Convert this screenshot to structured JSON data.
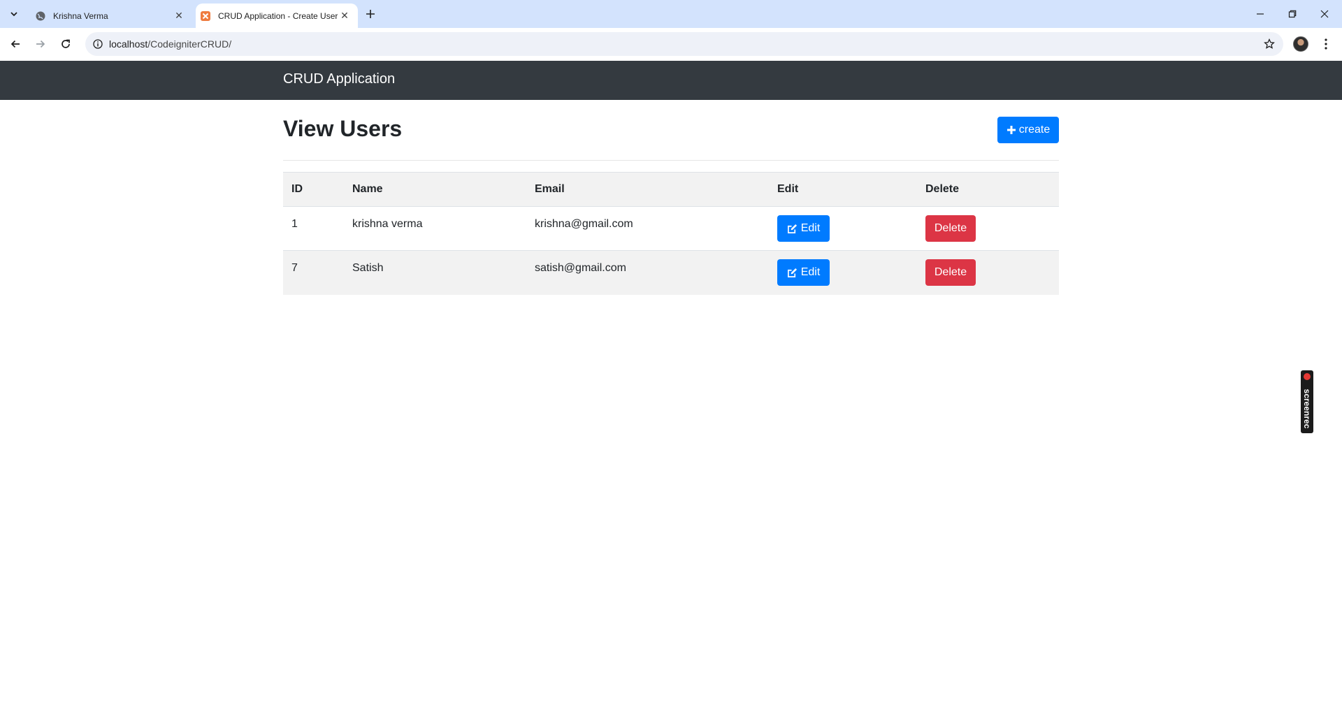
{
  "browser": {
    "tabs": [
      {
        "title": "Krishna Verma",
        "favicon": "globe-icon",
        "active": false
      },
      {
        "title": "CRUD Application - Create User",
        "favicon": "codeigniter-icon",
        "active": true
      }
    ],
    "url_host": "localhost",
    "url_path": "/CodeigniterCRUD/"
  },
  "navbar": {
    "brand": "CRUD Application",
    "bg_color": "#343a40"
  },
  "page": {
    "title": "View Users",
    "create_label": "create",
    "accent": "#007bff",
    "danger": "#dc3545"
  },
  "table": {
    "headers": {
      "id": "ID",
      "name": "Name",
      "email": "Email",
      "edit": "Edit",
      "delete": "Delete"
    },
    "rows": [
      {
        "id": "1",
        "name": "krishna verma",
        "email": "krishna@gmail.com",
        "edit": "Edit",
        "delete": "Delete"
      },
      {
        "id": "7",
        "name": "Satish",
        "email": "satish@gmail.com",
        "edit": "Edit",
        "delete": "Delete"
      }
    ]
  },
  "overlay": {
    "screenrec_label": "screenrec"
  }
}
